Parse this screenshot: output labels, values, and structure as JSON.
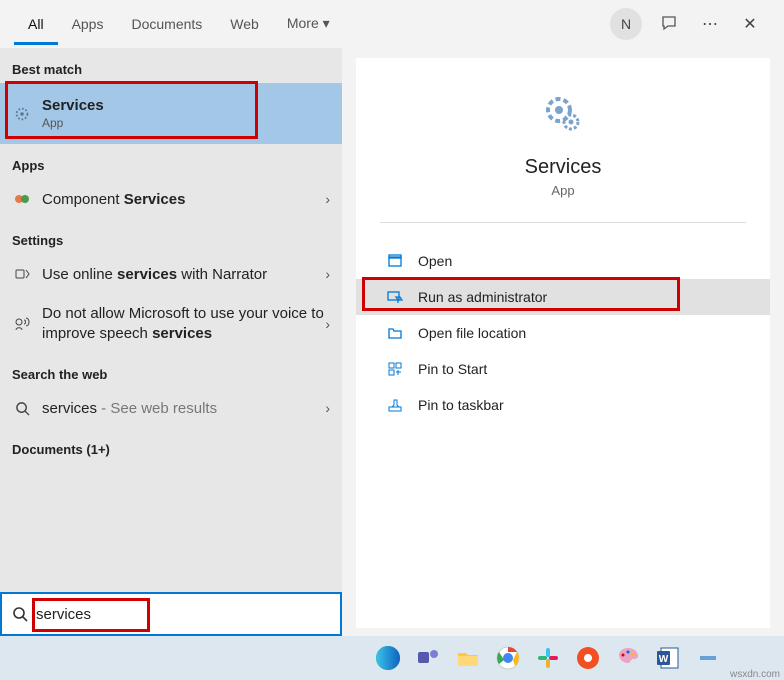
{
  "tabs": {
    "all": "All",
    "apps": "Apps",
    "documents": "Documents",
    "web": "Web",
    "more": "More ▾"
  },
  "avatar_initial": "N",
  "sections": {
    "best_match": "Best match",
    "apps": "Apps",
    "settings": "Settings",
    "search_web": "Search the web",
    "documents": "Documents (1+)"
  },
  "best": {
    "title": "Services",
    "sub": "App"
  },
  "apps_result": {
    "prefix": "Component ",
    "bold": "Services"
  },
  "settings_results": {
    "r1_a": "Use online ",
    "r1_b": "services",
    "r1_c": " with Narrator",
    "r2_a": "Do not allow Microsoft to use your voice to improve speech ",
    "r2_b": "services"
  },
  "web_result": {
    "term": "services",
    "suffix": " - See web results"
  },
  "detail": {
    "title": "Services",
    "type": "App"
  },
  "actions": {
    "open": "Open",
    "run_admin": "Run as administrator",
    "open_loc": "Open file location",
    "pin_start": "Pin to Start",
    "pin_taskbar": "Pin to taskbar"
  },
  "search_value": "services",
  "watermark": "wsxdn.com"
}
